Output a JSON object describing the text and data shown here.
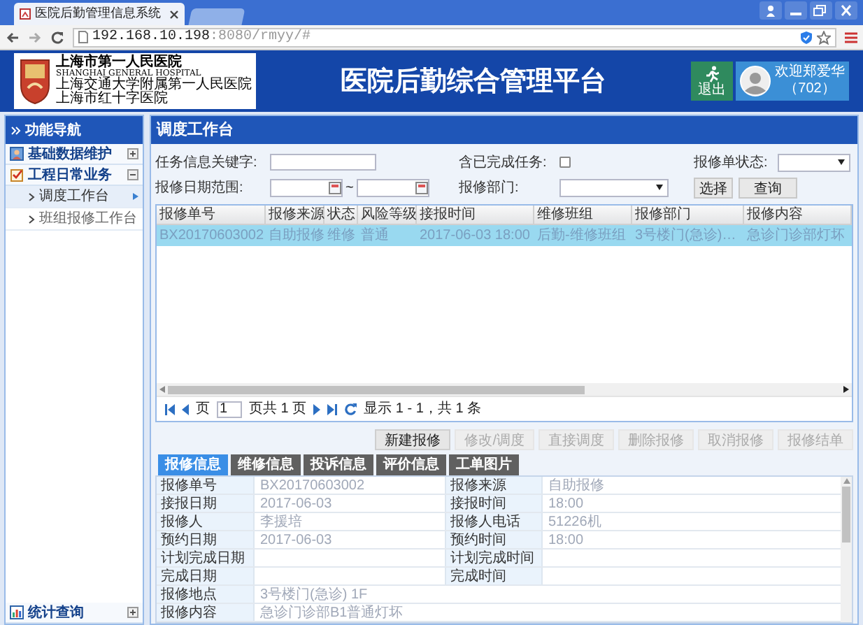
{
  "browser": {
    "tab_title": "医院后勤管理信息系统",
    "address_host": "192.168.10.198",
    "address_path": ":8080/rmyy/#"
  },
  "header": {
    "logo_lines": [
      "上海市第一人民医院",
      "SHANGHAI GENERAL HOSPITAL",
      "上海交通大学附属第一人民医院",
      "上海市红十字医院"
    ],
    "title": "医院后勤综合管理平台",
    "logout": "退出",
    "welcome": "欢迎郑爱华",
    "user_code": "（702）"
  },
  "sidebar": {
    "title": "功能导航",
    "groups": [
      {
        "label": "基础数据维护",
        "expanded": false
      },
      {
        "label": "工程日常业务",
        "expanded": true,
        "children": [
          {
            "label": "调度工作台",
            "selected": true
          },
          {
            "label": "班组报修工作台",
            "selected": false
          }
        ]
      }
    ],
    "bottom_group": {
      "label": "统计查询",
      "expanded": false
    }
  },
  "main": {
    "title": "调度工作台",
    "filters": {
      "keyword_label": "任务信息关键字:",
      "completed_label": "含已完成任务:",
      "completed_checked": false,
      "status_label": "报修单状态:",
      "date_label": "报修日期范围:",
      "date_sep": "~",
      "dept_label": "报修部门:",
      "choose_button": "选择",
      "query_button": "查询"
    },
    "table": {
      "columns": [
        "报修单号",
        "报修来源",
        "状态",
        "风险等级",
        "接报时间",
        "维修班组",
        "报修部门",
        "报修内容"
      ],
      "rows": [
        {
          "selected": true,
          "cells": [
            "BX20170603002",
            "自助报修",
            "维修",
            "普通",
            "2017-06-03 18:00",
            "后勤-维修班组",
            "3号楼门(急诊)…",
            "急诊门诊部灯坏"
          ]
        }
      ]
    },
    "pager": {
      "page_label": "页",
      "page": "1",
      "page_total": "页共 1 页",
      "summary": "显示 1 - 1，共 1 条"
    },
    "actions": [
      {
        "label": "新建报修",
        "disabled": false
      },
      {
        "label": "修改/调度",
        "disabled": true
      },
      {
        "label": "直接调度",
        "disabled": true
      },
      {
        "label": "删除报修",
        "disabled": true
      },
      {
        "label": "取消报修",
        "disabled": true
      },
      {
        "label": "报修结单",
        "disabled": true
      }
    ],
    "tabs": [
      {
        "label": "报修信息",
        "selected": true
      },
      {
        "label": "维修信息",
        "selected": false
      },
      {
        "label": "投诉信息",
        "selected": false
      },
      {
        "label": "评价信息",
        "selected": false
      },
      {
        "label": "工单图片",
        "selected": false
      }
    ],
    "details": [
      {
        "label": "报修单号",
        "value": "BX20170603002",
        "label_2": "报修来源",
        "value_2": "自助报修"
      },
      {
        "label": "接报日期",
        "value": "2017-06-03",
        "label_2": "接报时间",
        "value_2": "18:00"
      },
      {
        "label": "报修人",
        "value": "李援培",
        "label_2": "报修人电话",
        "value_2": "51226机"
      },
      {
        "label": "预约日期",
        "value": "2017-06-03",
        "label_2": "预约时间",
        "value_2": "18:00"
      },
      {
        "label": "计划完成日期",
        "label_2": "计划完成时间"
      },
      {
        "label": "完成日期",
        "label_2": "完成时间"
      },
      {
        "label": "报修地点",
        "value": "3号楼门(急诊) 1F"
      },
      {
        "label": "报修内容",
        "value": "急诊门诊部B1普通灯坏"
      }
    ]
  }
}
